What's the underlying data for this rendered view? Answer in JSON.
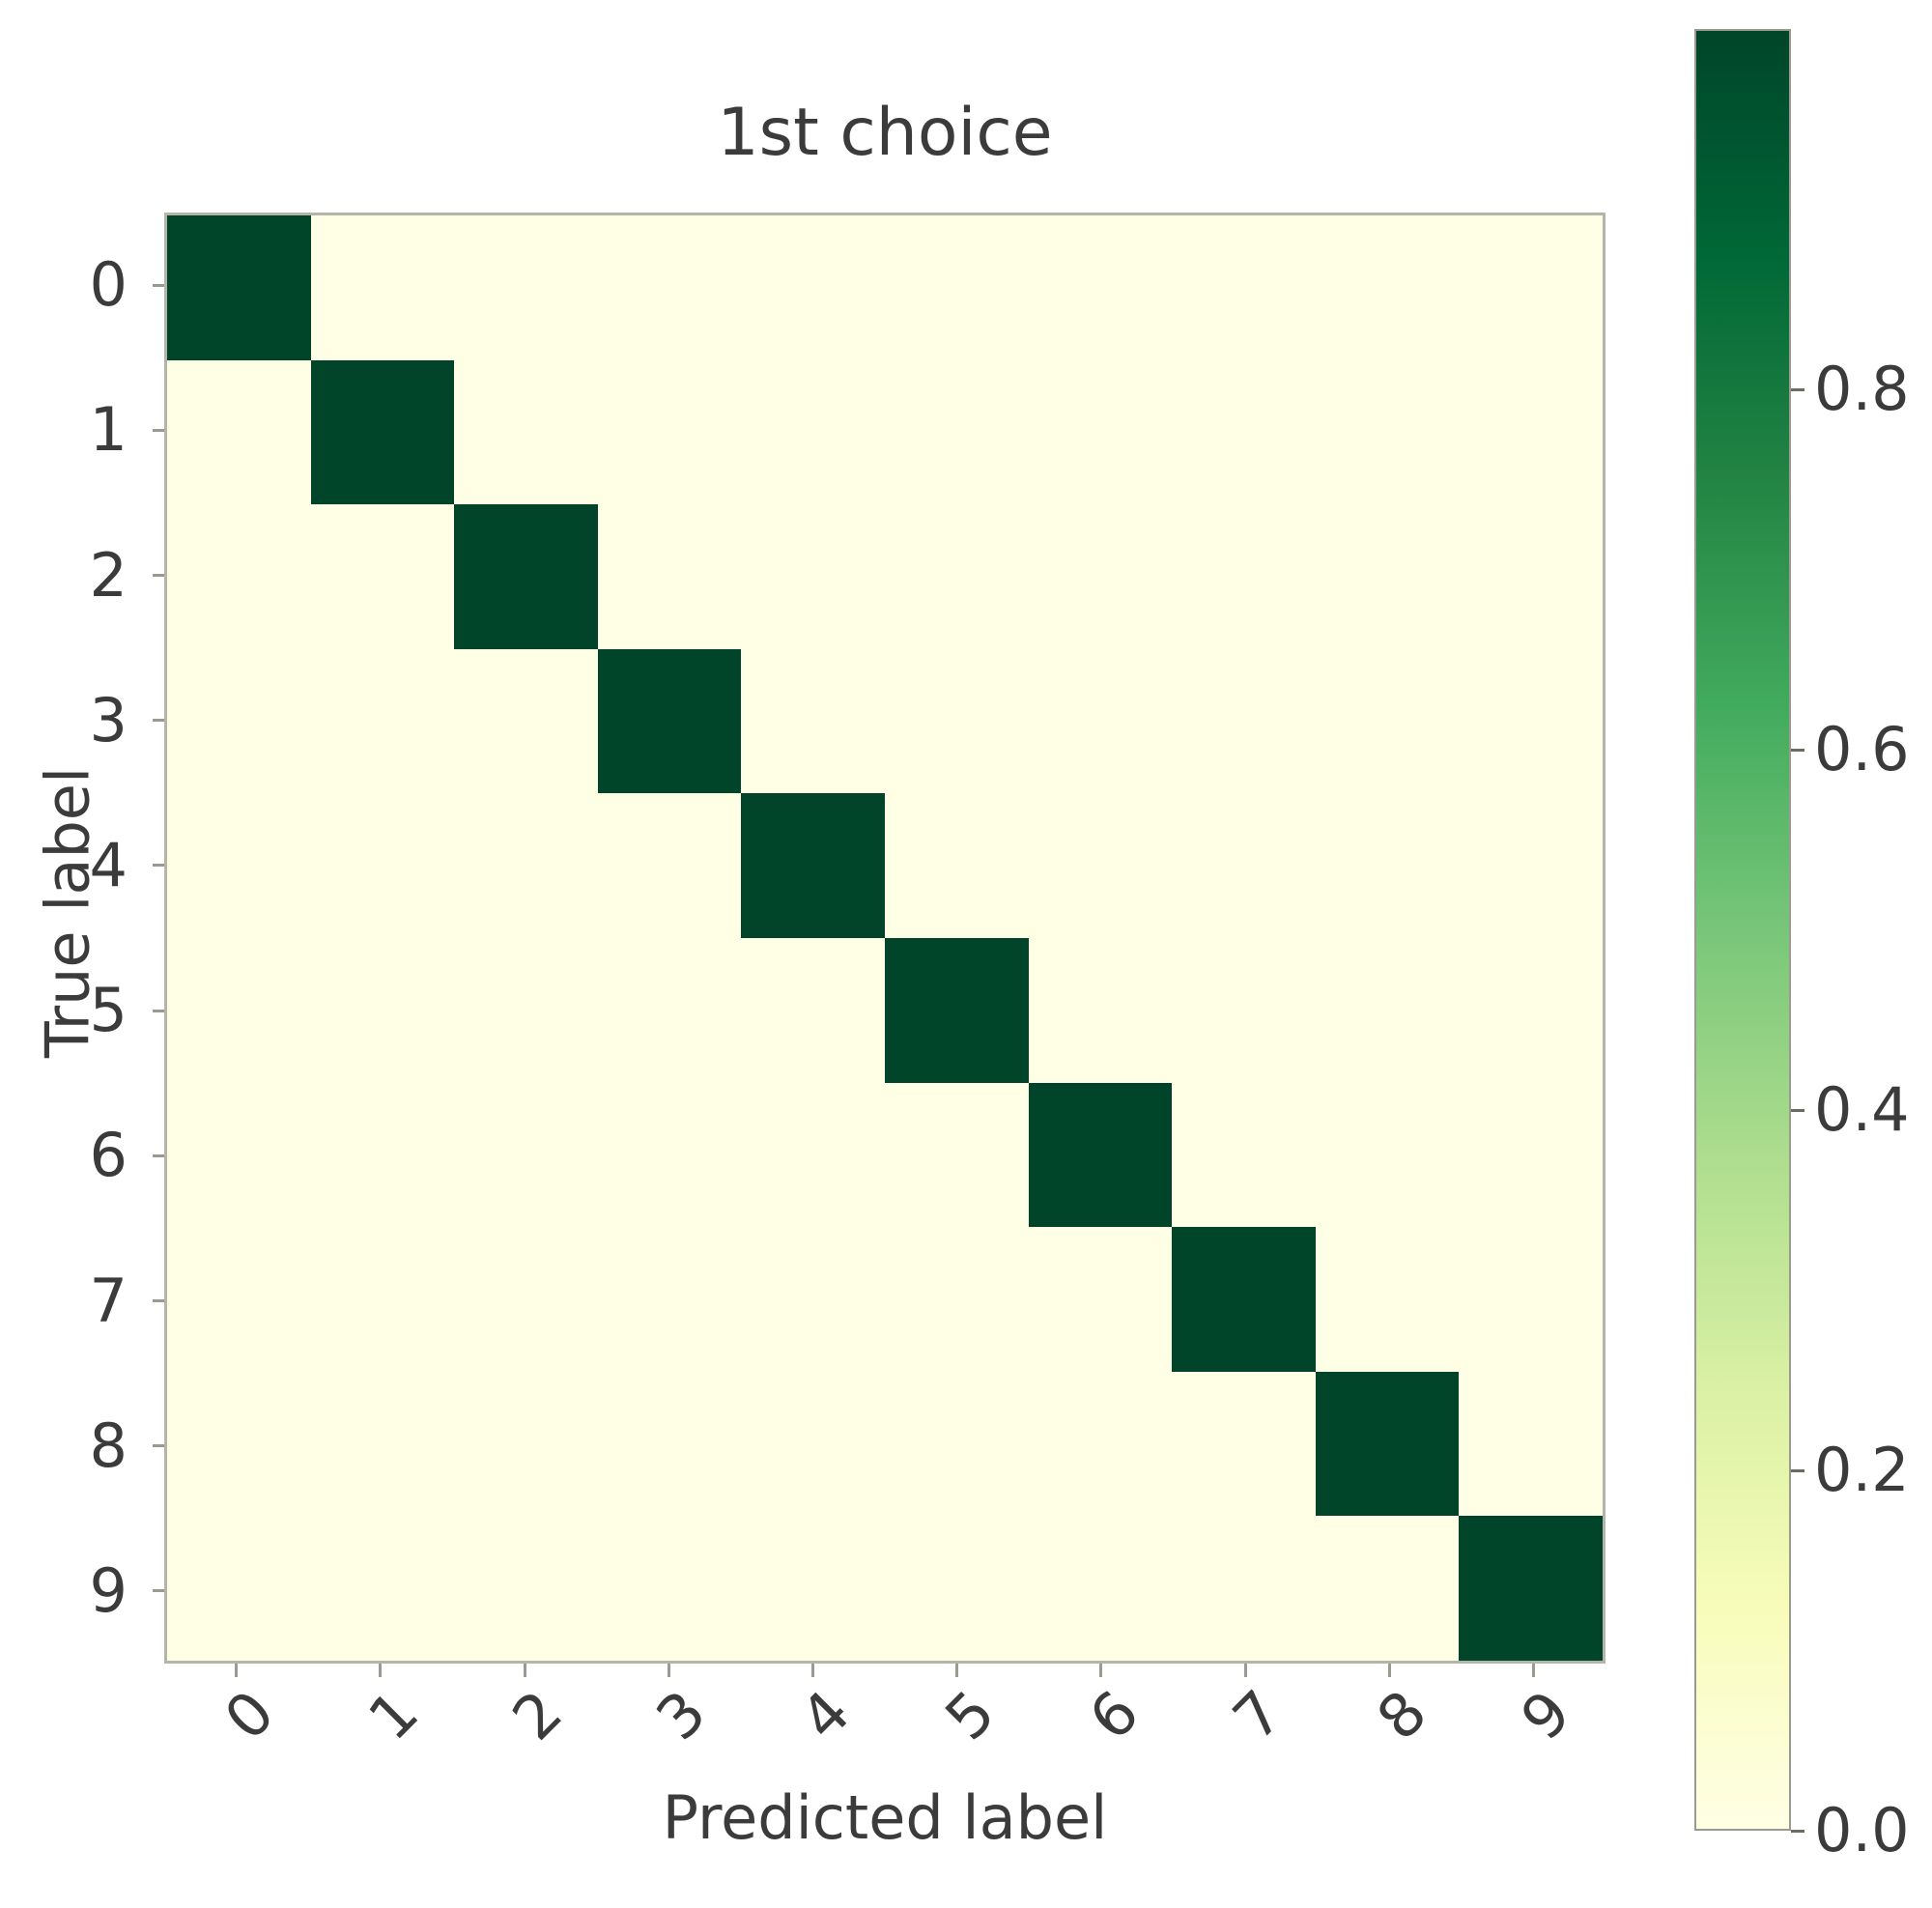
{
  "chart_data": {
    "type": "heatmap",
    "title": "1st choice",
    "xlabel": "Predicted label",
    "ylabel": "True label",
    "categories_x": [
      "0",
      "1",
      "2",
      "3",
      "4",
      "5",
      "6",
      "7",
      "8",
      "9"
    ],
    "categories_y": [
      "0",
      "1",
      "2",
      "3",
      "4",
      "5",
      "6",
      "7",
      "8",
      "9"
    ],
    "colormap": "YlGn",
    "colorbar": {
      "ticks": [
        "0.0",
        "0.2",
        "0.4",
        "0.6",
        "0.8"
      ],
      "tick_values": [
        0.0,
        0.2,
        0.4,
        0.6,
        0.8
      ],
      "vmin": 0.0,
      "vmax": 1.0,
      "position": "right",
      "low_color": "#ffffe5",
      "high_color": "#004529"
    },
    "grid": false,
    "values": [
      [
        1.0,
        0.0,
        0.0,
        0.0,
        0.0,
        0.0,
        0.0,
        0.0,
        0.0,
        0.0
      ],
      [
        0.0,
        1.0,
        0.0,
        0.0,
        0.0,
        0.0,
        0.0,
        0.0,
        0.0,
        0.0
      ],
      [
        0.0,
        0.0,
        1.0,
        0.0,
        0.0,
        0.0,
        0.0,
        0.0,
        0.0,
        0.0
      ],
      [
        0.0,
        0.0,
        0.0,
        1.0,
        0.0,
        0.0,
        0.0,
        0.0,
        0.0,
        0.0
      ],
      [
        0.0,
        0.0,
        0.0,
        0.0,
        1.0,
        0.0,
        0.0,
        0.0,
        0.0,
        0.0
      ],
      [
        0.0,
        0.0,
        0.0,
        0.0,
        0.0,
        1.0,
        0.0,
        0.0,
        0.0,
        0.0
      ],
      [
        0.0,
        0.0,
        0.0,
        0.0,
        0.0,
        0.0,
        1.0,
        0.0,
        0.0,
        0.0
      ],
      [
        0.0,
        0.0,
        0.0,
        0.0,
        0.0,
        0.0,
        0.0,
        1.0,
        0.0,
        0.0
      ],
      [
        0.0,
        0.0,
        0.0,
        0.0,
        0.0,
        0.0,
        0.0,
        0.0,
        1.0,
        0.0
      ],
      [
        0.0,
        0.0,
        0.0,
        0.0,
        0.0,
        0.0,
        0.0,
        0.0,
        0.0,
        1.0
      ]
    ]
  }
}
